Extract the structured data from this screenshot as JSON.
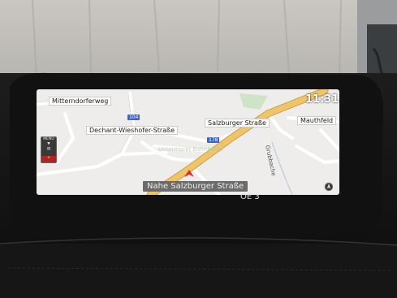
{
  "status": {
    "time": "11:31"
  },
  "map": {
    "streets": [
      {
        "label": "Mitterndorferweg"
      },
      {
        "label": "Dechant-Wieshofer-Straße"
      },
      {
        "label": "Salzburger Straße"
      },
      {
        "label": "Mauthfeld"
      },
      {
        "label": "Grubbache"
      }
    ],
    "road_badges": [
      "104",
      "178"
    ],
    "current_street": "Nahe Salzburger Straße",
    "speed_info": "OE 3",
    "menu_label": "MENU"
  },
  "colors": {
    "map_bg": "#eeedeb",
    "main_road": "#f0c56a",
    "position_marker": "#d6312b",
    "screen_bezel": "#111111"
  }
}
